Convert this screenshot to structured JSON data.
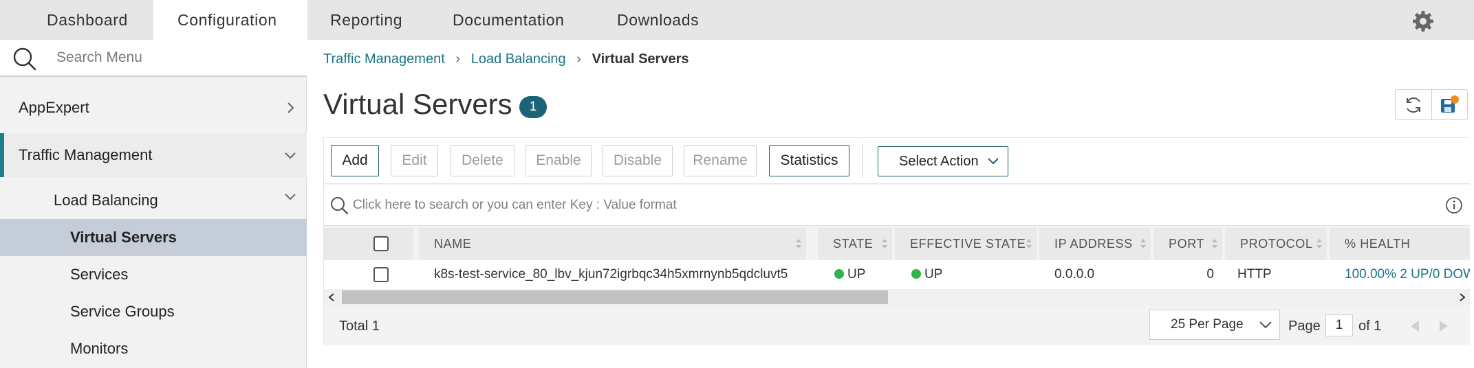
{
  "top_nav": {
    "tabs": [
      "Dashboard",
      "Configuration",
      "Reporting",
      "Documentation",
      "Downloads"
    ],
    "active_tab": "Configuration"
  },
  "sidebar": {
    "search_placeholder": "Search Menu",
    "items": [
      {
        "label": "AppExpert",
        "level": 1
      },
      {
        "label": "Traffic Management",
        "level": 1,
        "expanded": true
      },
      {
        "label": "Load Balancing",
        "level": 2,
        "expanded": true
      },
      {
        "label": "Virtual Servers",
        "level": 3,
        "selected": true
      },
      {
        "label": "Services",
        "level": 3
      },
      {
        "label": "Service Groups",
        "level": 3
      },
      {
        "label": "Monitors",
        "level": 3
      }
    ]
  },
  "breadcrumb": {
    "items": [
      "Traffic Management",
      "Load Balancing",
      "Virtual Servers"
    ]
  },
  "page": {
    "title": "Virtual Servers",
    "count": "1"
  },
  "toolbar": {
    "add": "Add",
    "edit": "Edit",
    "delete": "Delete",
    "enable": "Enable",
    "disable": "Disable",
    "rename": "Rename",
    "statistics": "Statistics",
    "select_action": "Select Action"
  },
  "filter": {
    "placeholder": "Click here to search or you can enter Key : Value format"
  },
  "table": {
    "columns": [
      "NAME",
      "STATE",
      "EFFECTIVE STATE",
      "IP ADDRESS",
      "PORT",
      "PROTOCOL",
      "% HEALTH"
    ],
    "rows": [
      {
        "name": "k8s-test-service_80_lbv_kjun72igrbqc34h5xmrnynb5qdcluvt5",
        "state": "UP",
        "effective_state": "UP",
        "ip_address": "0.0.0.0",
        "port": "0",
        "protocol": "HTTP",
        "health": "100.00% 2 UP/0 DOW"
      }
    ]
  },
  "footer": {
    "total": "Total 1",
    "per_page": "25 Per Page",
    "page_label": "Page",
    "page_value": "1",
    "of_label": "of 1"
  },
  "colors": {
    "accent": "#1a7385",
    "status_up": "#2fb34a",
    "badge": "#1a6378",
    "selected_row": "#c5cdd8"
  }
}
